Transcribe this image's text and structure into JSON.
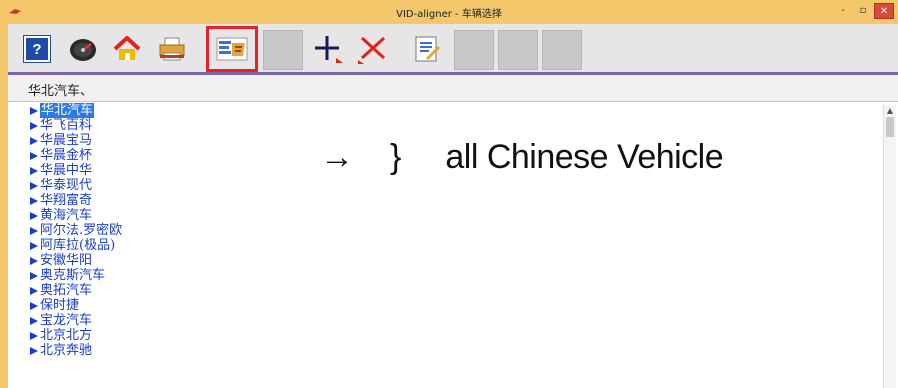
{
  "window": {
    "title": "VID-aligner - 车辆选择",
    "accent": "#f3c76a",
    "buttons": {
      "minimize": "-",
      "maximize": "▫",
      "close": "✕"
    }
  },
  "toolbar": {
    "buttons": [
      {
        "name": "help",
        "icon": "help-icon",
        "label": "?"
      },
      {
        "name": "speedometer",
        "icon": "speedometer-icon"
      },
      {
        "name": "home",
        "icon": "home-icon"
      },
      {
        "name": "print",
        "icon": "printer-icon"
      },
      {
        "name": "vehicle-select",
        "icon": "vehicle-select-icon",
        "selected": true
      },
      {
        "name": "blank-1",
        "icon": ""
      },
      {
        "name": "add",
        "icon": "plus-icon"
      },
      {
        "name": "delete",
        "icon": "delete-icon"
      },
      {
        "name": "edit",
        "icon": "document-edit-icon"
      },
      {
        "name": "blank-2",
        "icon": ""
      },
      {
        "name": "blank-3",
        "icon": ""
      },
      {
        "name": "blank-4",
        "icon": ""
      }
    ]
  },
  "path": {
    "text": "华北汽车、"
  },
  "list": {
    "items": [
      {
        "label": "华北汽车",
        "selected": true
      },
      {
        "label": "华飞百科"
      },
      {
        "label": "华晨宝马"
      },
      {
        "label": "华晨金杯"
      },
      {
        "label": "华晨中华"
      },
      {
        "label": "华泰现代"
      },
      {
        "label": "华翔富奇"
      },
      {
        "label": "黄海汽车"
      },
      {
        "label": "阿尔法.罗密欧"
      },
      {
        "label": "阿库拉(极品)"
      },
      {
        "label": "安徽华阳"
      },
      {
        "label": "奥克斯汽车"
      },
      {
        "label": "奥拓汽车"
      },
      {
        "label": "保时捷"
      },
      {
        "label": "宝龙汽车"
      },
      {
        "label": "北京北方"
      },
      {
        "label": "北京奔驰"
      }
    ]
  },
  "annotation": {
    "arrow": "→",
    "brace": "}",
    "text": "all Chinese Vehicle"
  },
  "colors": {
    "toolbar_border": "#7a64a6",
    "selected_outline": "#e8222a",
    "list_text": "#1a3ccf",
    "selection_bg": "#2a7ae2"
  }
}
